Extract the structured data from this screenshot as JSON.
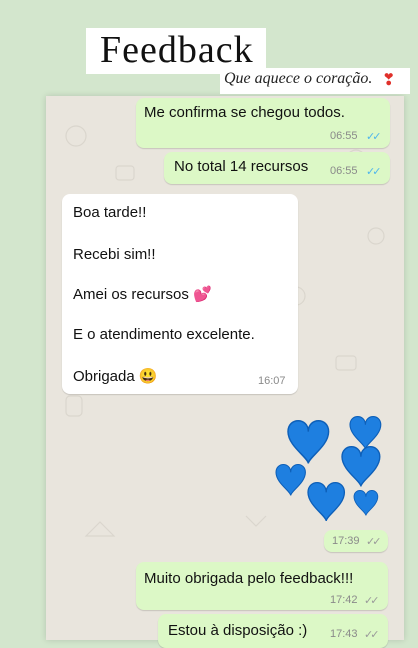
{
  "header": {
    "title": "Feedback",
    "subtitle": "Que aquece o coração.",
    "subtitle_icon": "heart-exclamation-icon"
  },
  "messages": [
    {
      "direction": "out",
      "text": "Me confirma se chegou todos.",
      "time": "06:55",
      "status": "read"
    },
    {
      "direction": "out",
      "text": "No total 14 recursos",
      "time": "06:55",
      "status": "read"
    },
    {
      "direction": "in",
      "lines": [
        "Boa tarde!!",
        "Recebi sim!!",
        "Amei os recursos 💕",
        "E o atendimento excelente.",
        "Obrigada 😃"
      ],
      "time": "16:07"
    },
    {
      "direction": "out",
      "kind": "hearts-sticker",
      "time": "17:39",
      "status": "delivered"
    },
    {
      "direction": "out",
      "text": "Muito obrigada pelo feedback!!!",
      "time": "17:42",
      "status": "delivered"
    },
    {
      "direction": "out",
      "text": "Estou à disposição :)",
      "time": "17:43",
      "status": "delivered"
    }
  ],
  "colors": {
    "outgoing_bubble": "#dcf8c6",
    "incoming_bubble": "#ffffff",
    "chat_background": "#e9e5dd",
    "read_ticks": "#4fb6ec",
    "heart_blue": "#1e7fe0"
  },
  "ticks_glyph": "✓✓"
}
